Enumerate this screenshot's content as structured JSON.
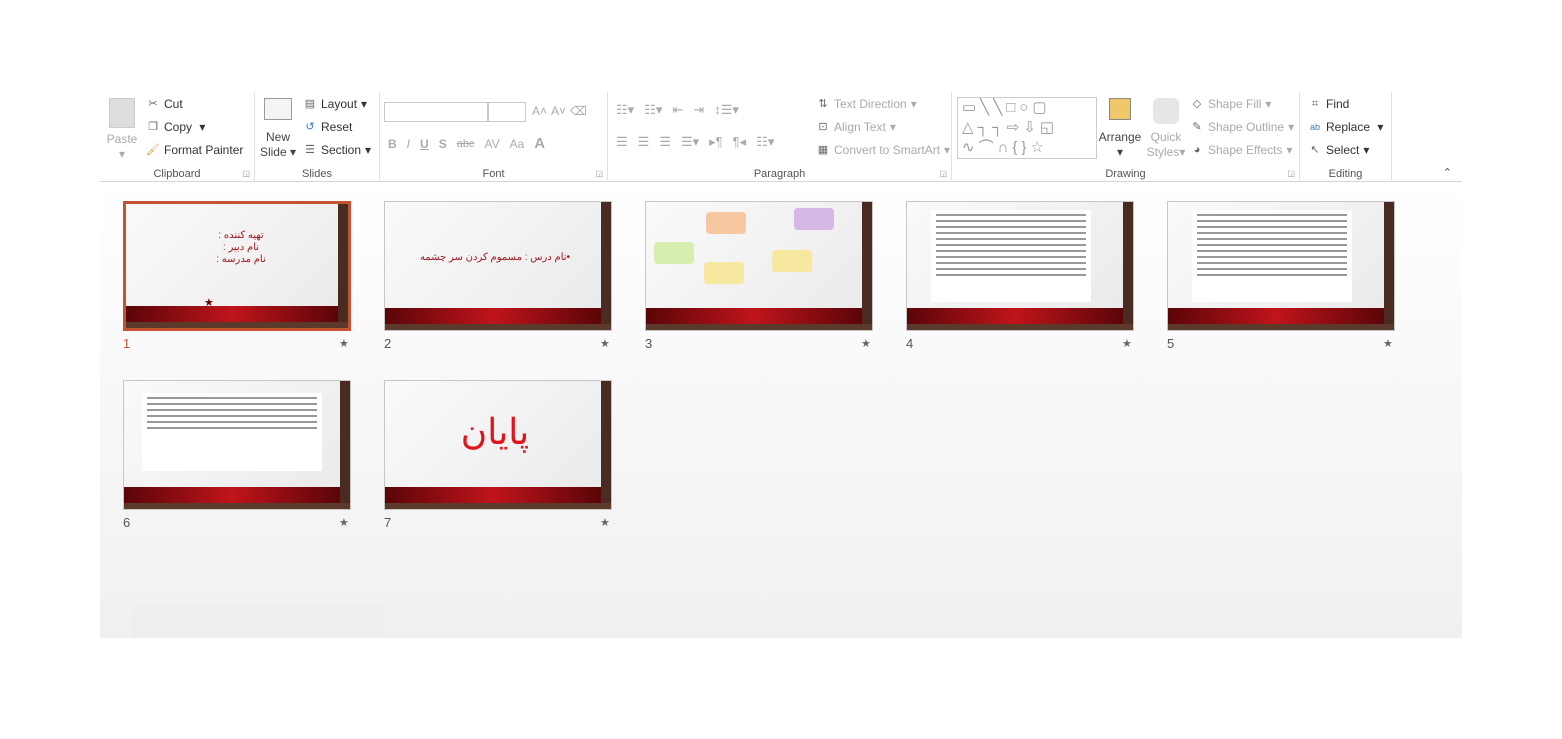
{
  "ribbon": {
    "clipboard": {
      "label": "Clipboard",
      "paste": "Paste",
      "cut": "Cut",
      "copy": "Copy",
      "format_painter": "Format Painter"
    },
    "slides": {
      "label": "Slides",
      "new_slide_1": "New",
      "new_slide_2": "Slide",
      "layout": "Layout",
      "reset": "Reset",
      "section": "Section"
    },
    "font": {
      "label": "Font",
      "font_name": "",
      "font_size": "",
      "bold": "B",
      "italic": "I",
      "underline": "U",
      "shadow": "S",
      "strike": "abc",
      "spacing": "AV",
      "case": "Aa",
      "color": "A"
    },
    "paragraph": {
      "label": "Paragraph",
      "text_direction": "Text Direction",
      "align_text": "Align Text",
      "smartart": "Convert to SmartArt"
    },
    "drawing": {
      "label": "Drawing",
      "arrange": "Arrange",
      "quick_styles_1": "Quick",
      "quick_styles_2": "Styles",
      "shape_fill": "Shape Fill",
      "shape_outline": "Shape Outline",
      "shape_effects": "Shape Effects"
    },
    "editing": {
      "label": "Editing",
      "find": "Find",
      "replace": "Replace",
      "select": "Select"
    }
  },
  "slides": [
    {
      "number": "1",
      "selected": true,
      "lines": [
        "تهیه کننده :",
        "نام دبیر :",
        "نام مدرسه :"
      ]
    },
    {
      "number": "2",
      "title": "•نام درس : مسموم کردن سر چشمه"
    },
    {
      "number": "3"
    },
    {
      "number": "4"
    },
    {
      "number": "5"
    },
    {
      "number": "6"
    },
    {
      "number": "7",
      "title": "پایان"
    }
  ],
  "colors": {
    "accent": "#c5532f",
    "slide_red": "#c0141b"
  }
}
